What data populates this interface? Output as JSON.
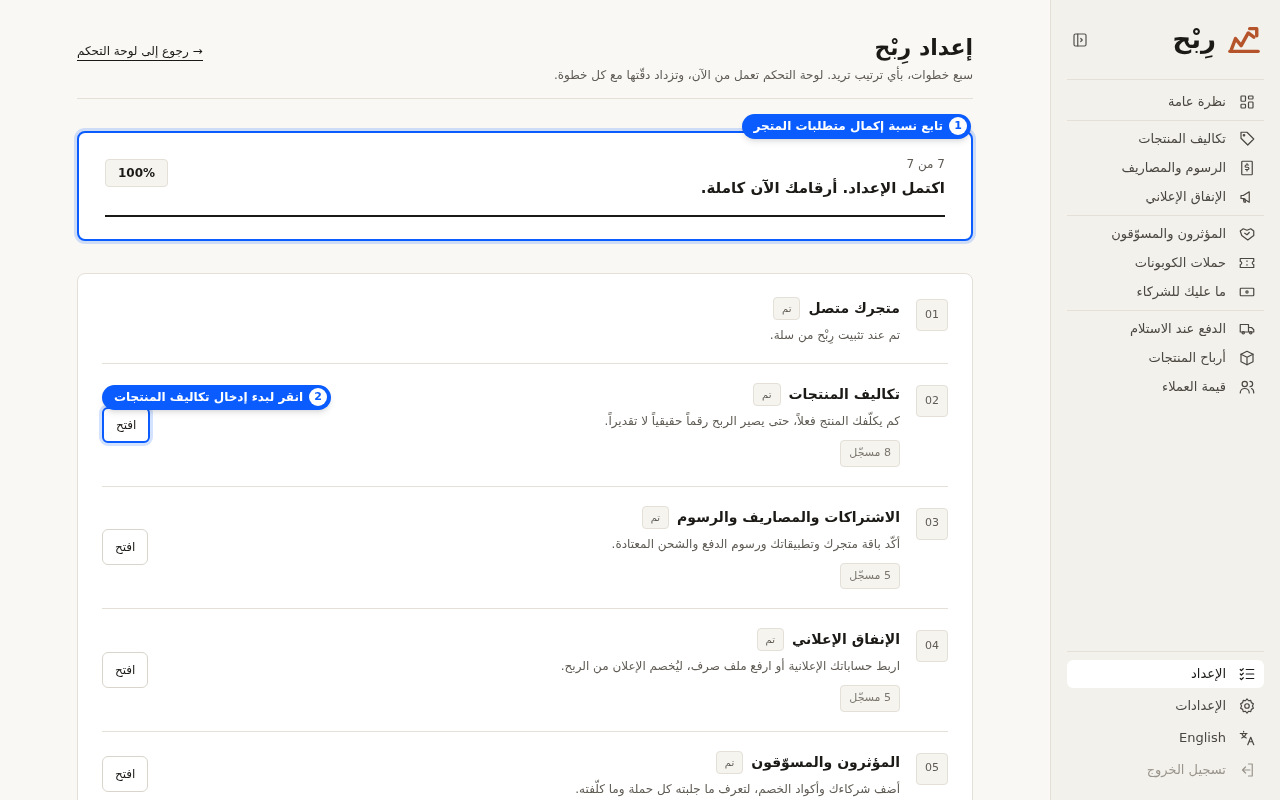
{
  "sidebar": {
    "brand": "رِبْح",
    "groups": [
      [
        {
          "label": "نظرة عامة",
          "selected": false
        }
      ],
      [
        {
          "label": "تكاليف المنتجات",
          "selected": false
        },
        {
          "label": "الرسوم والمصاريف",
          "selected": false
        },
        {
          "label": "الإنفاق الإعلاني",
          "selected": false
        }
      ],
      [
        {
          "label": "المؤثرون والمسوّقون",
          "selected": false
        },
        {
          "label": "حملات الكوبونات",
          "selected": false
        },
        {
          "label": "ما عليك للشركاء",
          "selected": false
        }
      ],
      [
        {
          "label": "الدفع عند الاستلام",
          "selected": false
        },
        {
          "label": "أرباح المنتجات",
          "selected": false
        },
        {
          "label": "قيمة العملاء",
          "selected": false
        }
      ]
    ],
    "bottom_items": [
      {
        "label": "الإعداد",
        "selected": true,
        "disabled": false
      },
      {
        "label": "الإعدادات",
        "selected": false,
        "disabled": false
      },
      {
        "label": "English",
        "selected": false,
        "disabled": false
      },
      {
        "label": "تسجيل الخروج",
        "selected": false,
        "disabled": true
      }
    ]
  },
  "header": {
    "title": "إعداد رِبْح",
    "subtitle": "سبع خطوات، بأي ترتيب تريد. لوحة التحكم تعمل من الآن، وتزداد دقّتها مع كل خطوة.",
    "back_link": "→ رجوع إلى لوحة التحكم"
  },
  "progress": {
    "highlighted": true,
    "hint": {
      "number": "1",
      "text": "تابع نسبة إكمال متطلبات المتجر"
    },
    "count": "7 من 7",
    "message": "اكتمل الإعداد. أرقامك الآن كاملة.",
    "percent": "100%",
    "level": 1
  },
  "steps": [
    {
      "number": "01",
      "title": "متجرك متصل",
      "status": "تم",
      "description": "تم عند تثبيت رِبْح من سلة."
    },
    {
      "number": "02",
      "title": "تكاليف المنتجات",
      "status": "تم",
      "description": "كم يكلّفك المنتج فعلاً، حتى يصير الربح رقماً حقيقياً لا تقديراً.",
      "count": "8 مسجّل",
      "action": "افتح",
      "highlighted": true,
      "hint": {
        "number": "2",
        "text": "انقر لبدء إدخال تكاليف المنتجات"
      }
    },
    {
      "number": "03",
      "title": "الاشتراكات والمصاريف والرسوم",
      "status": "تم",
      "description": "أكّد باقة متجرك وتطبيقاتك ورسوم الدفع والشحن المعتادة.",
      "count": "5 مسجّل",
      "action": "افتح",
      "highlighted": false
    },
    {
      "number": "04",
      "title": "الإنفاق الإعلاني",
      "status": "تم",
      "description": "اربط حساباتك الإعلانية أو ارفع ملف صرف، ليُخصم الإعلان من الربح.",
      "count": "5 مسجّل",
      "action": "افتح",
      "highlighted": false
    },
    {
      "number": "05",
      "title": "المؤثرون والمسوّقون",
      "status": "تم",
      "description": "أضف شركاءك وأكواد الخصم، لتعرف ما جلبته كل حملة وما كلّفته.",
      "action": "افتح",
      "highlighted": false
    }
  ]
}
